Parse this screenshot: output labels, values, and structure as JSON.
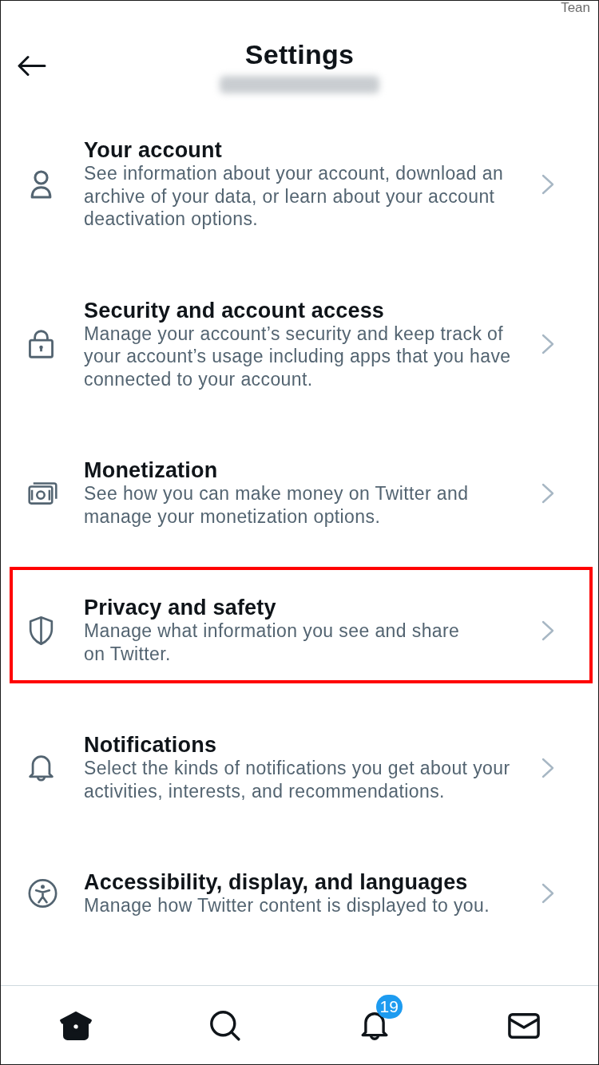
{
  "status_bar": {
    "text": "Tean"
  },
  "header": {
    "title": "Settings"
  },
  "items": [
    {
      "kind": "person",
      "title": "Your account",
      "description": "See information about your account, download an\narchive of your data, or learn about your account\ndeactivation options.",
      "highlighted": false
    },
    {
      "kind": "lock",
      "title": "Security and account access",
      "description": "Manage your account’s security and keep track of\nyour account’s usage including apps that you have\nconnected to your account.",
      "highlighted": false
    },
    {
      "kind": "money",
      "title": "Monetization",
      "description": "See how you can make money on Twitter and\nmanage your monetization options.",
      "highlighted": false
    },
    {
      "kind": "shield",
      "title": "Privacy and safety",
      "description": "Manage what information you see and share\non Twitter.",
      "highlighted": true
    },
    {
      "kind": "bell",
      "title": "Notifications",
      "description": "Select the kinds of notifications you get about your\nactivities, interests, and recommendations.",
      "highlighted": false
    },
    {
      "kind": "accessibility",
      "title": "Accessibility, display, and languages",
      "description": "Manage how Twitter content is displayed to you.",
      "highlighted": false
    }
  ],
  "bottom_nav": [
    {
      "kind": "home",
      "selected": true
    },
    {
      "kind": "search",
      "selected": false
    },
    {
      "kind": "bell",
      "selected": false,
      "badge": "19"
    },
    {
      "kind": "mail",
      "selected": false
    }
  ]
}
